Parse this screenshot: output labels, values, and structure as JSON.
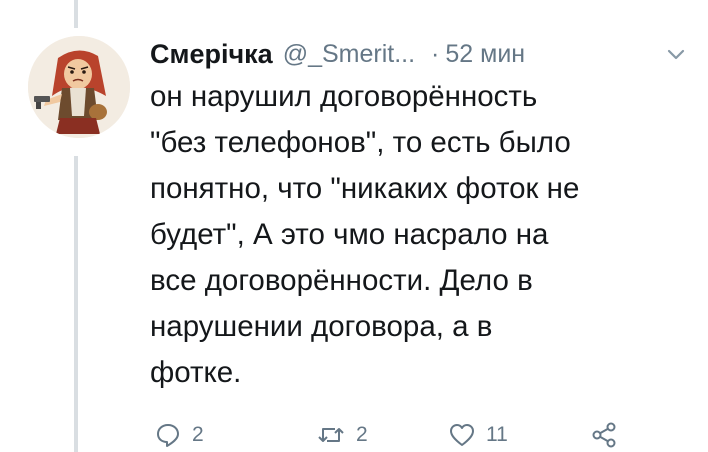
{
  "author": {
    "display_name": "Смерічка",
    "handle": "@_Smerit...",
    "separator": "·",
    "timestamp": "52 мин"
  },
  "tweet": {
    "lines": [
      "он нарушил договорённость",
      "\"без телефонов\", то есть было",
      "понятно, что \"никаких фоток не",
      "будет\", А это чмо насрало на",
      "все договорённости. Дело в",
      "нарушении договора, а в",
      "фотке."
    ]
  },
  "actions": {
    "reply_count": "2",
    "retweet_count": "2",
    "like_count": "11"
  },
  "icons": {
    "reply": "reply-icon",
    "retweet": "retweet-icon",
    "like": "heart-icon",
    "share": "share-icon",
    "caret": "chevron-down-icon"
  },
  "colors": {
    "text": "#14171a",
    "secondary": "#657786",
    "thread_line": "#d9dee2"
  }
}
